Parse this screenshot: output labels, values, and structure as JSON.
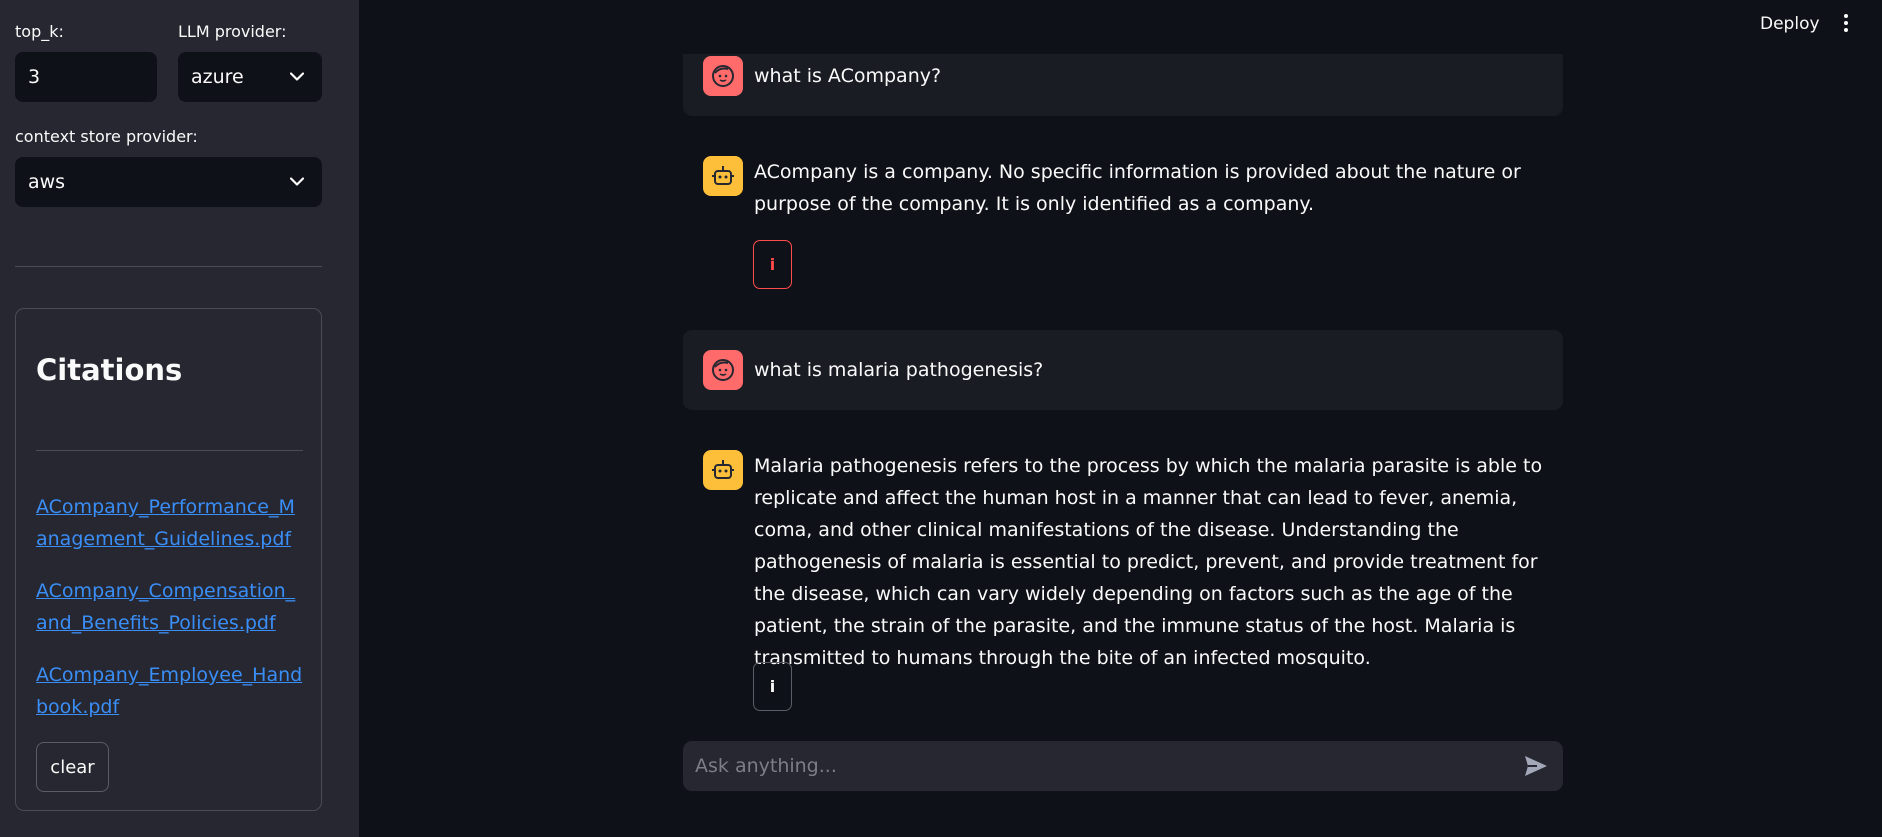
{
  "header": {
    "deploy_label": "Deploy"
  },
  "sidebar": {
    "top_k_label": "top_k:",
    "top_k_value": "3",
    "llm_provider_label": "LLM provider:",
    "llm_provider_value": "azure",
    "context_store_label": "context store provider:",
    "context_store_value": "aws",
    "citations": {
      "title": "Citations",
      "links": [
        "ACompany_Performance_Management_Guidelines.pdf",
        "ACompany_Compensation_and_Benefits_Policies.pdf",
        "ACompany_Employee_Handbook.pdf"
      ],
      "clear_label": "clear"
    }
  },
  "chat": {
    "messages": [
      {
        "role": "user",
        "text": "what is ACompany?"
      },
      {
        "role": "assistant",
        "text": "ACompany is a company. No specific information is provided about the nature or purpose of the company. It is only identified as a company.",
        "info": "i"
      },
      {
        "role": "user",
        "text": "what is malaria pathogenesis?"
      },
      {
        "role": "assistant",
        "text": "Malaria pathogenesis refers to the process by which the malaria parasite is able to replicate and affect the human host in a manner that can lead to fever, anemia, coma, and other clinical manifestations of the disease. Understanding the pathogenesis of malaria is essential to predict, prevent, and provide treatment for the disease, which can vary widely depending on factors such as the age of the patient, the strain of the parasite, and the immune status of the host. Malaria is transmitted to humans through the bite of an infected mosquito.",
        "info": "i"
      }
    ],
    "input_placeholder": "Ask anything..."
  },
  "colors": {
    "background": "#0e1117",
    "sidebar": "#262730",
    "link": "#3a8ef7",
    "user_avatar": "#ff6b6b",
    "bot_avatar": "#fdbf3a",
    "alert_border": "#ff4b4b"
  },
  "icons": {
    "user_avatar": "user-face-icon",
    "bot_avatar": "robot-icon",
    "info": "info-icon",
    "send": "send-icon",
    "menu": "kebab-menu-icon",
    "select": "chevron-down-icon"
  }
}
